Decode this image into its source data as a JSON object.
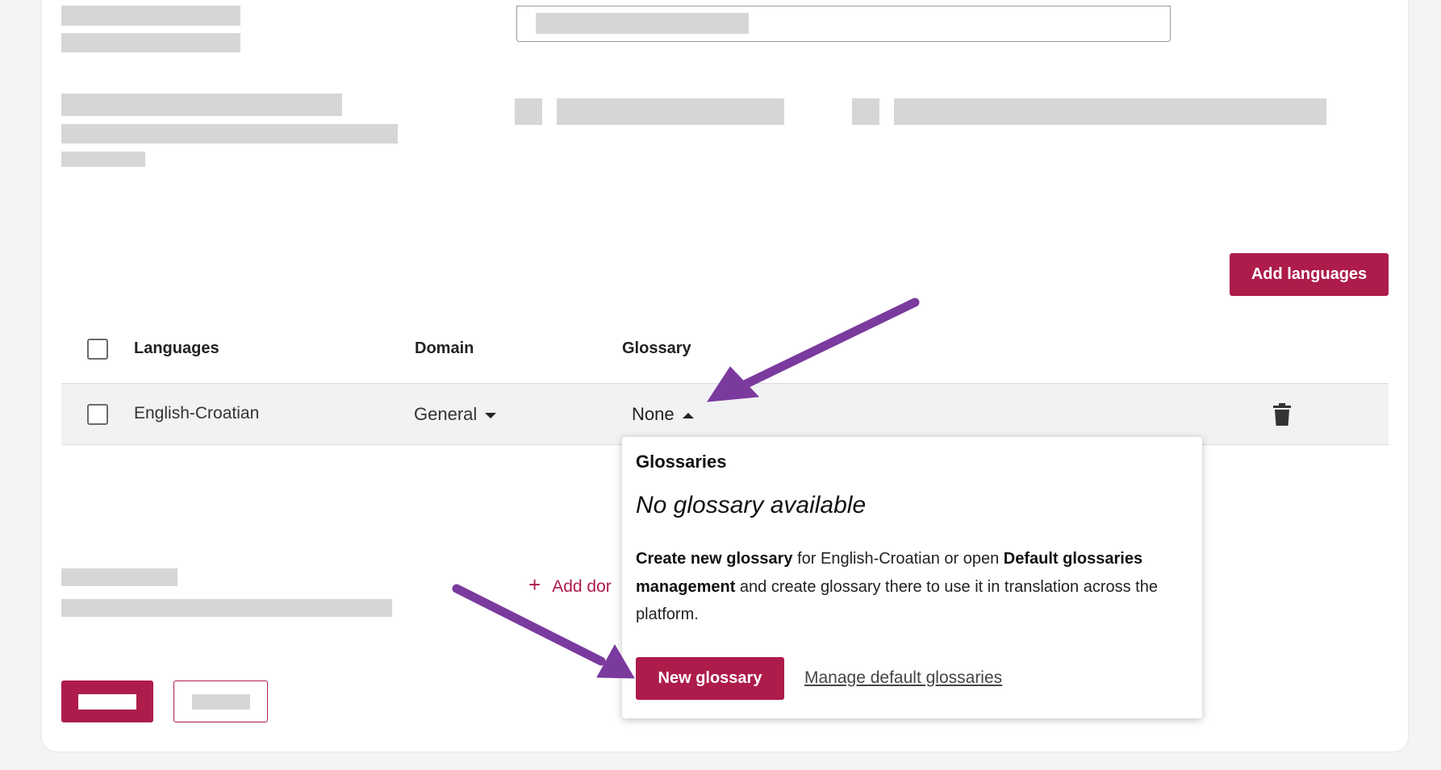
{
  "toolbar": {
    "add_languages": "Add languages"
  },
  "table": {
    "headers": {
      "languages": "Languages",
      "domain": "Domain",
      "glossary": "Glossary"
    },
    "rows": [
      {
        "language": "English-Croatian",
        "domain": "General",
        "glossary": "None"
      }
    ]
  },
  "add_domain": {
    "icon": "plus-icon",
    "label": "Add dor"
  },
  "popup": {
    "title": "Glossaries",
    "empty": "No glossary available",
    "desc_b1": "Create new glossary",
    "desc_1": " for English-Croatian or open ",
    "desc_b2": "Default glossaries management",
    "desc_2": " and create glossary there to use it in translation across the platform.",
    "new_button": "New glossary",
    "manage_link": "Manage default glossaries"
  },
  "colors": {
    "accent": "#ad1c4a",
    "annotation_arrow": "#7b3a9e"
  }
}
